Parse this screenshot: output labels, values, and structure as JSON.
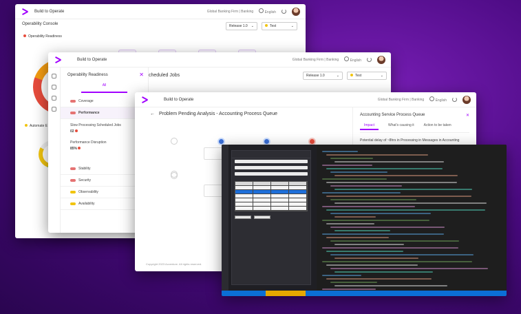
{
  "app": {
    "title": "Build to Operate",
    "breadcrumb": "Global Banking Firm | Banking",
    "language": "English"
  },
  "colors": {
    "accent": "#a100ff",
    "background": "#4b0a82",
    "status_red": "#e74c3c",
    "status_green": "#2ecc71",
    "ide_status_bar": "#0b6fd6"
  },
  "icons": [
    "accenture-logo-icon",
    "globe-icon",
    "refresh-icon",
    "close-icon",
    "back-arrow-icon",
    "filter-icon",
    "clipboard-icon"
  ],
  "window1": {
    "title": "Operability Console",
    "section_label": "Operability Readiness",
    "side_label": "Automate E",
    "release": "Release 1.0",
    "test": "Test"
  },
  "window2": {
    "panel_title": "Operability Readiness",
    "tab_all": "All",
    "heading_fragment": "cheduled Jobs",
    "release": "Release 1.0",
    "test": "Test",
    "items": [
      {
        "label": "Coverage",
        "color": "#e57373"
      },
      {
        "label": "Performance",
        "color": "#e57373"
      }
    ],
    "metric1": {
      "label": "Slow Processing Scheduled Jobs",
      "value": "02"
    },
    "metric2": {
      "label": "Performance Disruption",
      "value": "85%"
    },
    "items_bottom": [
      {
        "label": "Stability",
        "color": "#e57373"
      },
      {
        "label": "Security",
        "color": "#e57373"
      },
      {
        "label": "Observability",
        "color": "#f1c40f"
      },
      {
        "label": "Availability",
        "color": "#f1c40f"
      }
    ]
  },
  "window3": {
    "title": "Problem Pending Analysis - Accounting Process Queue",
    "side_title": "Accounting Service Process Queue",
    "tabs": [
      "Impact",
      "What's causing it",
      "Action to be taken"
    ],
    "side_text": "Potential delay of ~8hrs in Processing in Messages in Accounting",
    "copyright": "Copyright 2023 Accenture. All rights reserved."
  }
}
